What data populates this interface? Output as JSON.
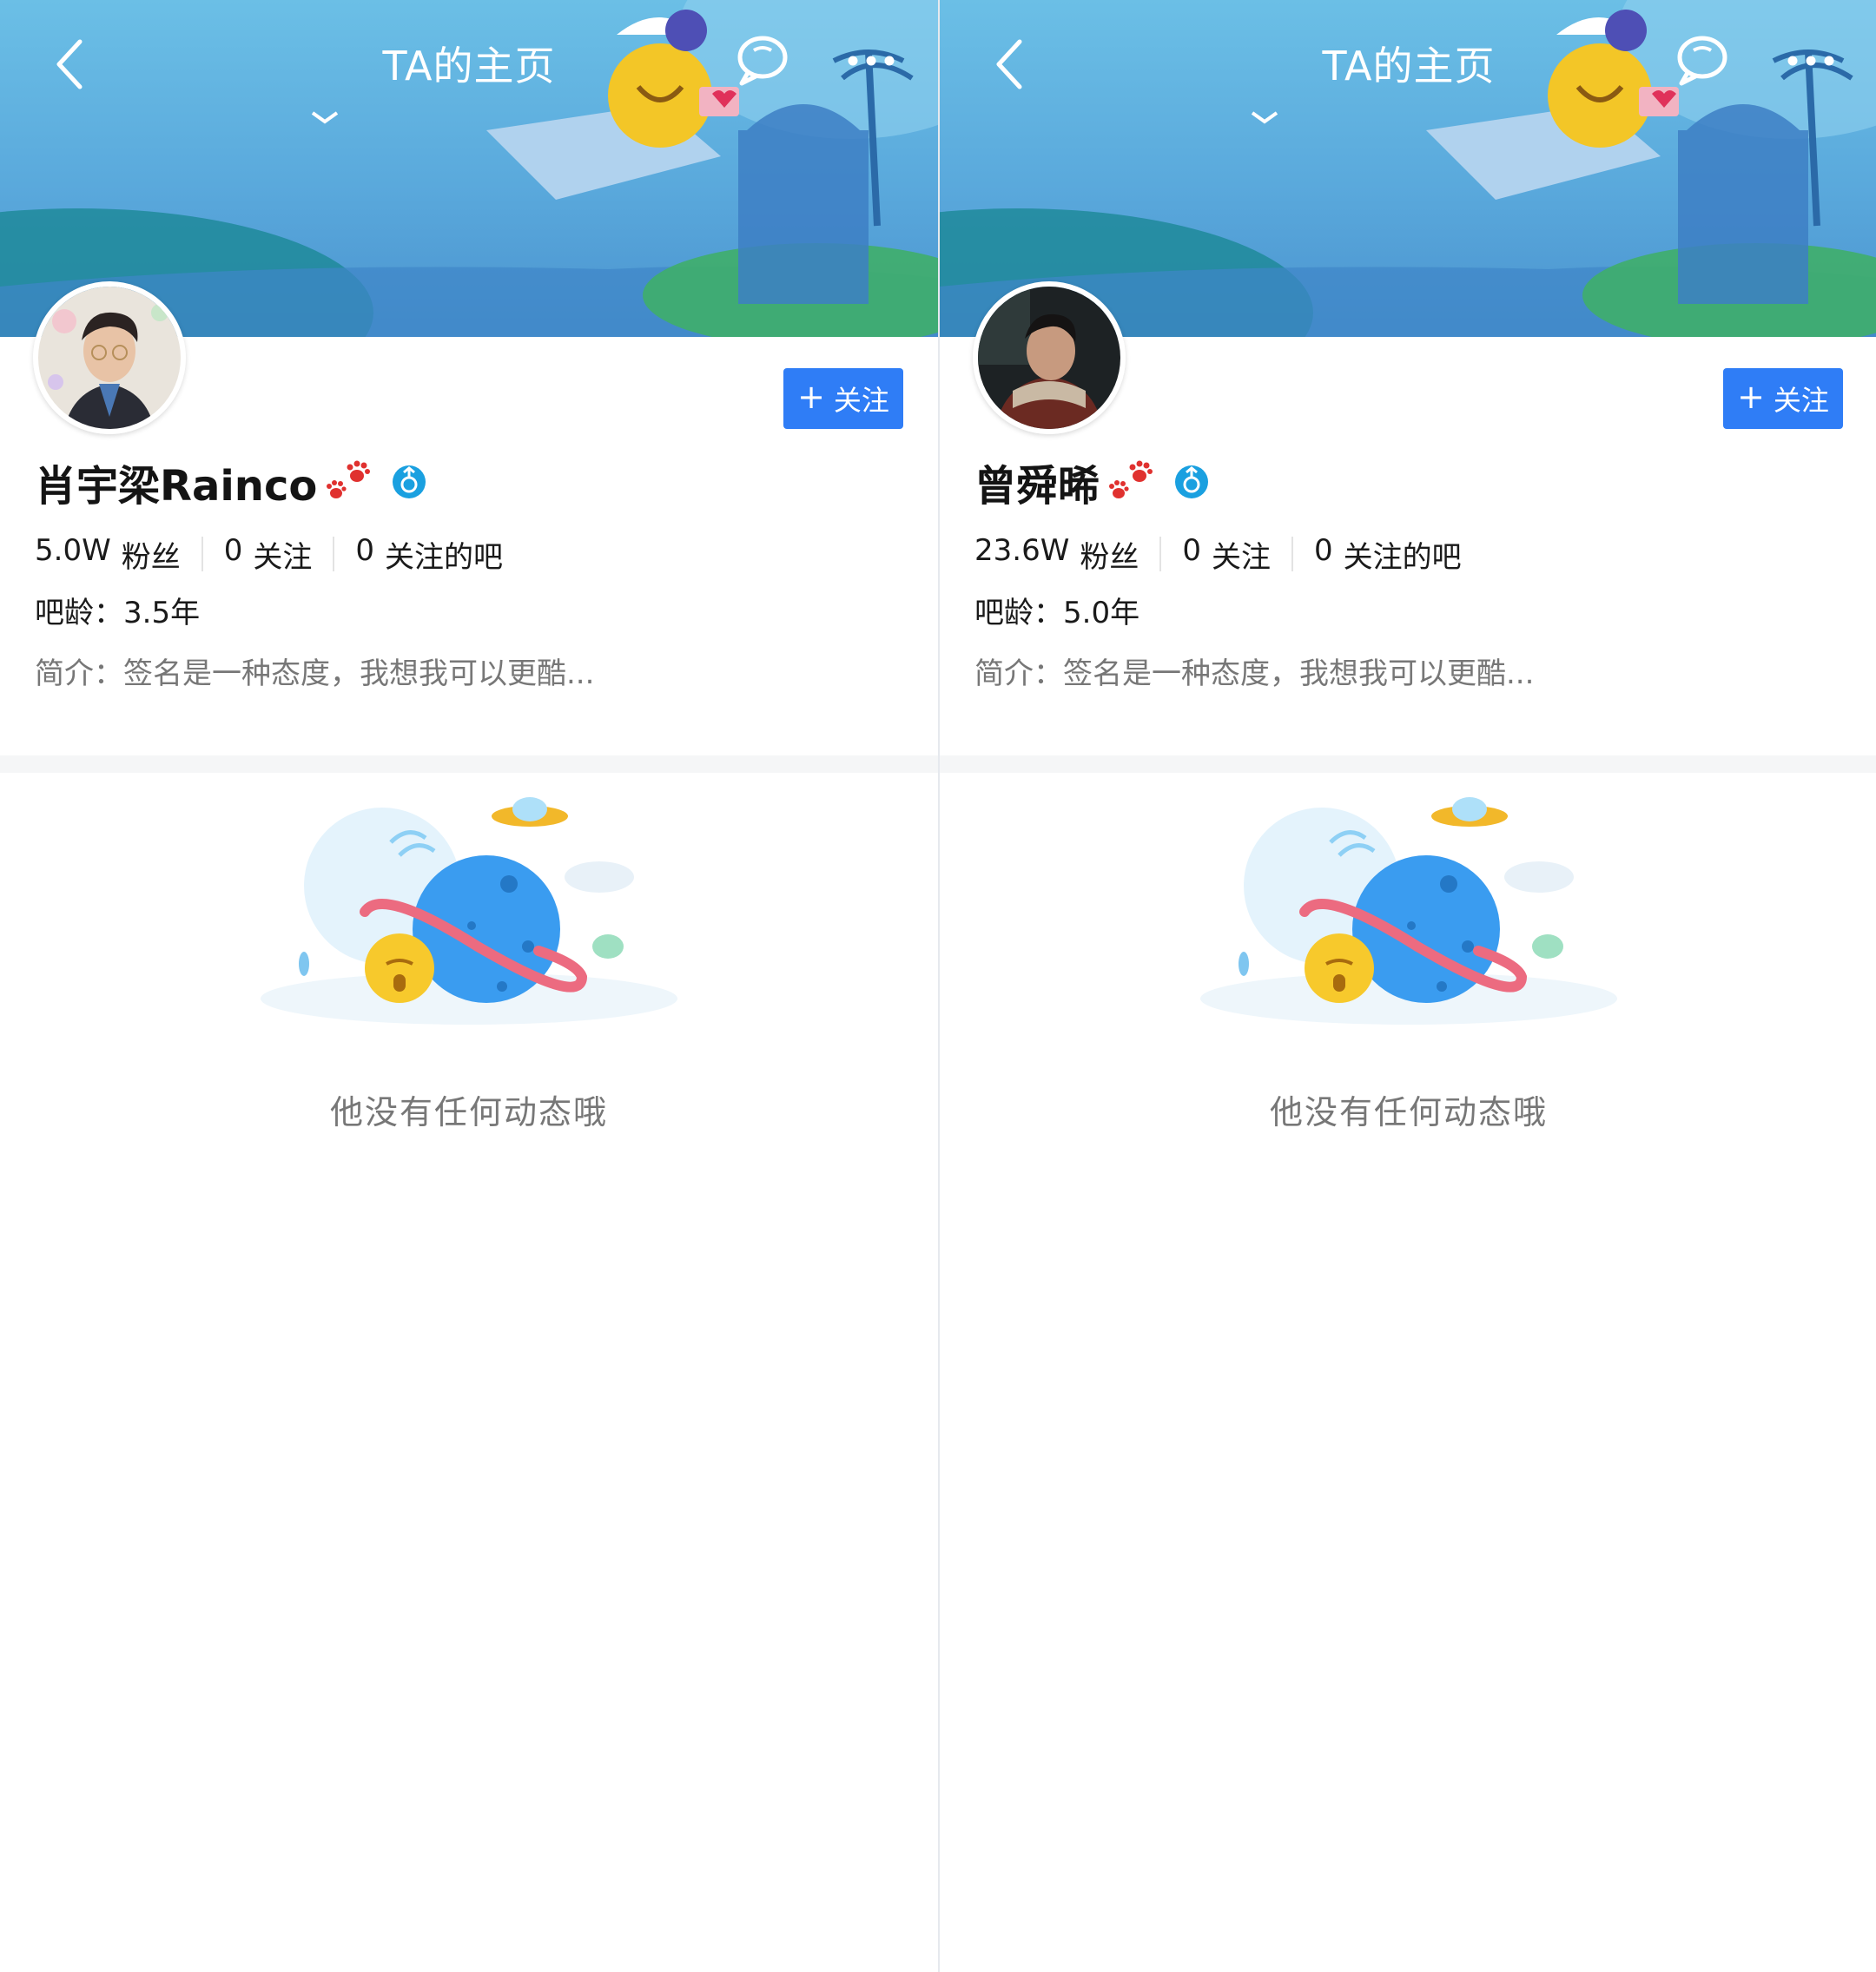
{
  "colors": {
    "accent": "#2f7df6",
    "banner_top": "#6bbfe6",
    "banner_bottom": "#4a93cf",
    "muted_text": "#777777",
    "badge_blue": "#1aa0e0"
  },
  "icons": {
    "back": "chevron-left-icon",
    "message": "chat-bubble-icon",
    "more": "more-dots-icon",
    "follow": "plus-icon",
    "paw": "paw-icon",
    "gender": "male-badge-icon"
  },
  "panels": [
    {
      "header": {
        "title": "TA的主页"
      },
      "profile": {
        "name": "肖宇梁Rainco",
        "follow_label": "关注",
        "follow_plus": "+",
        "stats": [
          {
            "value": "5.0W",
            "label": "粉丝"
          },
          {
            "value": "0",
            "label": "关注"
          },
          {
            "value": "0",
            "label": "关注的吧"
          }
        ],
        "age": "吧龄：3.5年",
        "intro": "简介：签名是一种态度，我想我可以更酷..."
      },
      "empty": {
        "message": "他没有任何动态哦"
      }
    },
    {
      "header": {
        "title": "TA的主页"
      },
      "profile": {
        "name": "曾舜晞",
        "follow_label": "关注",
        "follow_plus": "+",
        "stats": [
          {
            "value": "23.6W",
            "label": "粉丝"
          },
          {
            "value": "0",
            "label": "关注"
          },
          {
            "value": "0",
            "label": "关注的吧"
          }
        ],
        "age": "吧龄：5.0年",
        "intro": "简介：签名是一种态度，我想我可以更酷..."
      },
      "empty": {
        "message": "他没有任何动态哦"
      }
    }
  ]
}
